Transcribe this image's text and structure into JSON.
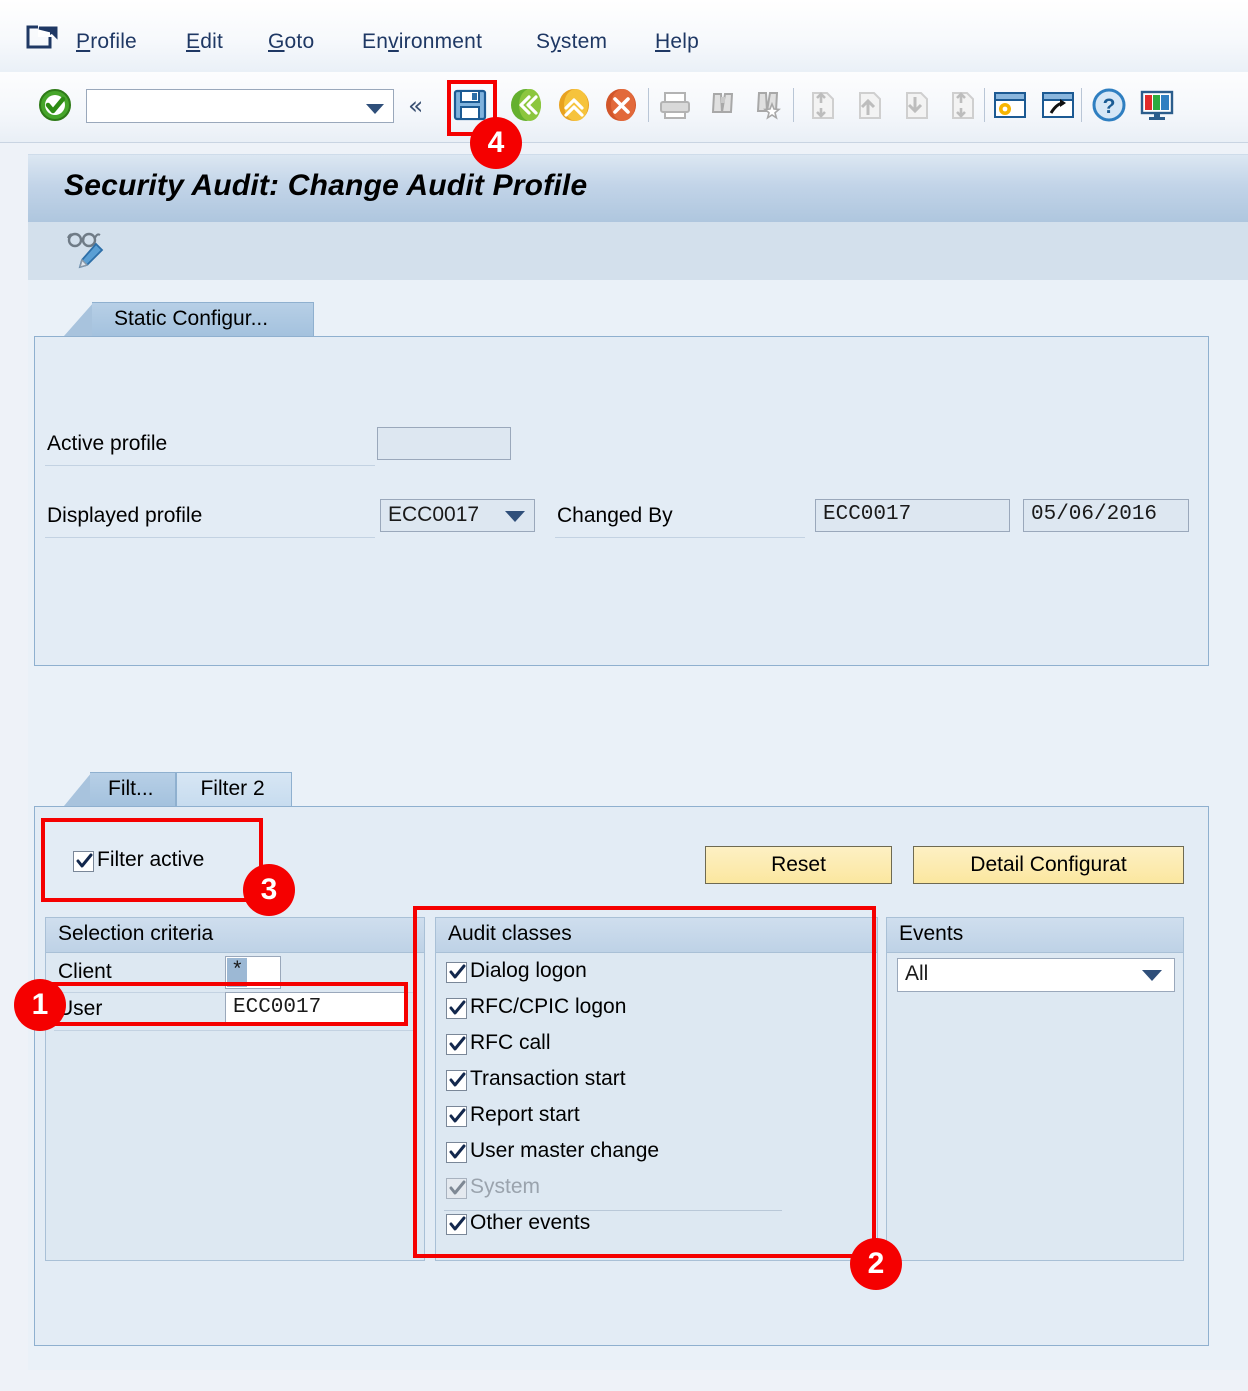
{
  "menu": {
    "system_icon": "sap-session-icon",
    "items": [
      {
        "label": "Profile",
        "accel_index": 0
      },
      {
        "label": "Edit",
        "accel_index": 0
      },
      {
        "label": "Goto",
        "accel_index": 0
      },
      {
        "label": "Environment",
        "accel_index": 2
      },
      {
        "label": "System",
        "accel_index": 1
      },
      {
        "label": "Help",
        "accel_index": 0
      }
    ]
  },
  "toolbar": {
    "ok_icon": "green-check-icon",
    "command_field_value": "",
    "command_field_placeholder": "",
    "command_dropdown_icon": "chevron-down-icon",
    "collapse_icon": "double-chevron-left-icon",
    "icons": [
      "save-icon",
      "back-green-icon",
      "exit-yellow-icon",
      "cancel-red-icon",
      "print-icon",
      "find-icon",
      "find-next-icon",
      "first-page-icon",
      "previous-page-icon",
      "next-page-icon",
      "last-page-icon",
      "customize-local-layout-icon",
      "new-window-icon",
      "help-icon",
      "layout-menu-icon"
    ]
  },
  "page": {
    "title": "Security Audit: Change Audit Profile"
  },
  "apptoolbar": {
    "icon": "display-change-glasses-pencil-icon"
  },
  "static_config": {
    "tab_label": "Static Configur...",
    "active_profile": {
      "label": "Active profile",
      "value": ""
    },
    "displayed_profile": {
      "label": "Displayed profile",
      "value": "ECC0017",
      "dropdown_icon": "chevron-down-icon"
    },
    "changed_by": {
      "label": "Changed By",
      "user": "ECC0017",
      "date": "05/06/2016"
    }
  },
  "filter": {
    "tabs": [
      {
        "label": "Filt...",
        "selected": true
      },
      {
        "label": "Filter 2",
        "selected": false
      }
    ],
    "filter_active": {
      "label": "Filter active",
      "checked": true
    },
    "buttons": {
      "reset": "Reset",
      "detail": "Detail Configurat"
    },
    "selection_criteria": {
      "title": "Selection criteria",
      "client": {
        "label": "Client",
        "value": "*"
      },
      "user": {
        "label": "User",
        "value": "ECC0017"
      }
    },
    "audit_classes": {
      "title": "Audit classes",
      "items": [
        {
          "label": "Dialog logon",
          "checked": true,
          "disabled": false
        },
        {
          "label": "RFC/CPIC logon",
          "checked": true,
          "disabled": false
        },
        {
          "label": "RFC call",
          "checked": true,
          "disabled": false
        },
        {
          "label": "Transaction start",
          "checked": true,
          "disabled": false
        },
        {
          "label": "Report start",
          "checked": true,
          "disabled": false
        },
        {
          "label": "User master change",
          "checked": true,
          "disabled": false
        },
        {
          "label": "System",
          "checked": true,
          "disabled": true
        },
        {
          "label": "Other events",
          "checked": true,
          "disabled": false
        }
      ]
    },
    "events": {
      "title": "Events",
      "value": "All",
      "dropdown_icon": "chevron-down-icon"
    }
  },
  "annotations": {
    "color": "#f50000",
    "badges": [
      {
        "number": "1",
        "target": "user-field"
      },
      {
        "number": "2",
        "target": "audit-classes-group"
      },
      {
        "number": "3",
        "target": "filter-active-checkbox"
      },
      {
        "number": "4",
        "target": "save-toolbar-button"
      }
    ]
  }
}
